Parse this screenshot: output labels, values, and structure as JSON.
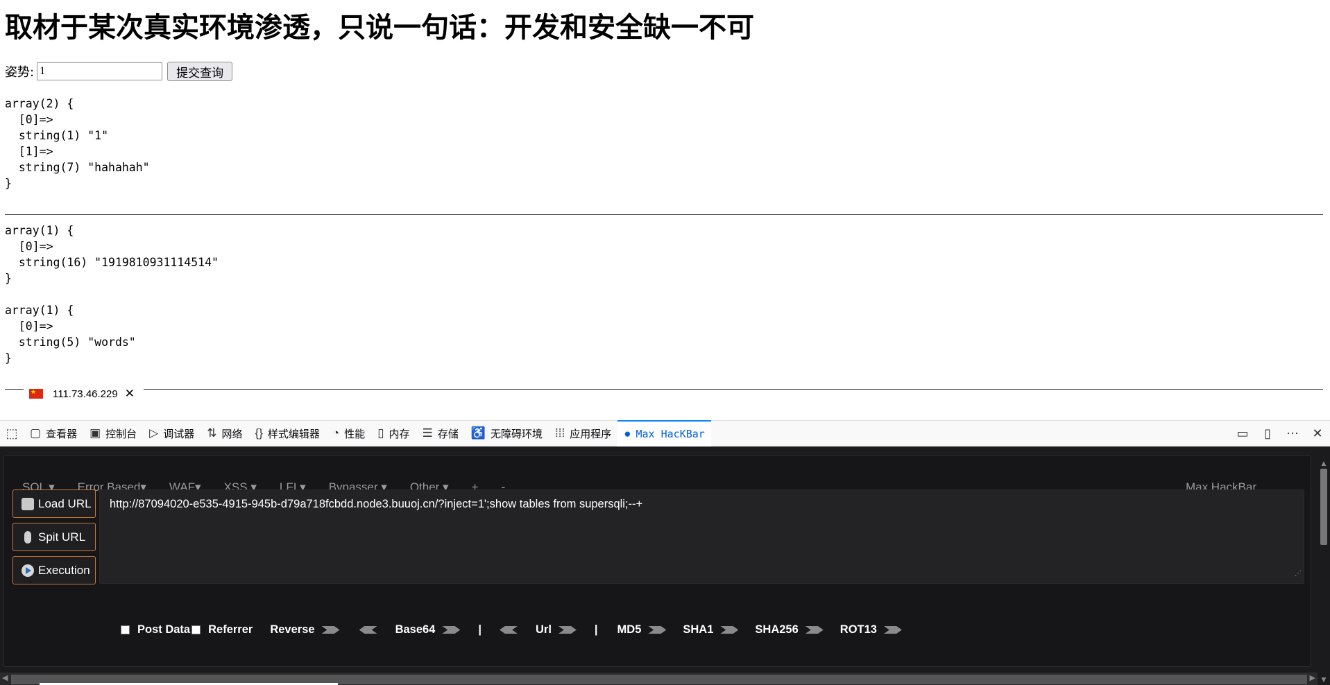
{
  "page": {
    "title": "取材于某次真实环境渗透，只说一句话：开发和安全缺一不可",
    "form": {
      "label": "姿势:",
      "value": "1",
      "submit_label": "提交查询"
    },
    "dump1": "array(2) {\n  [0]=>\n  string(1) \"1\"\n  [1]=>\n  string(7) \"hahahah\"\n}",
    "dump2": "array(1) {\n  [0]=>\n  string(16) \"1919810931114514\"\n}",
    "dump3": "array(1) {\n  [0]=>\n  string(5) \"words\"\n}",
    "ip": "111.73.46.229"
  },
  "devtools": {
    "tabs": [
      {
        "label": "查看器",
        "icon": "inspector-icon"
      },
      {
        "label": "控制台",
        "icon": "console-icon"
      },
      {
        "label": "调试器",
        "icon": "debugger-icon"
      },
      {
        "label": "网络",
        "icon": "network-icon"
      },
      {
        "label": "样式编辑器",
        "icon": "style-editor-icon"
      },
      {
        "label": "性能",
        "icon": "performance-icon"
      },
      {
        "label": "内存",
        "icon": "memory-icon"
      },
      {
        "label": "存储",
        "icon": "storage-icon"
      },
      {
        "label": "无障碍环境",
        "icon": "accessibility-icon"
      },
      {
        "label": "应用程序",
        "icon": "application-icon"
      },
      {
        "label": "Max HacKBar",
        "icon": "hackbar-icon",
        "active": true
      }
    ],
    "active_color": "#0060df"
  },
  "hackbar": {
    "menu": [
      "SQL ▾",
      "Error Based▾",
      "WAF▾",
      "XSS ▾",
      "LFI ▾",
      "Bypasser ▾",
      "Other ▾",
      "+",
      "-"
    ],
    "brand": "Max HackBar",
    "buttons": {
      "load": "Load URL",
      "split": "Spit URL",
      "exec": "Execution"
    },
    "url": "http://87094020-e535-4915-945b-d79a718fcbdd.node3.buuoj.cn/?inject=1';show tables from supersqli;--+",
    "options": {
      "post_data": "Post Data",
      "referrer": "Referrer",
      "reverse": "Reverse",
      "base64": "Base64",
      "pipe": "|",
      "url": "Url",
      "md5": "MD5",
      "sha1": "SHA1",
      "sha256": "SHA256",
      "rot13": "ROT13"
    },
    "border_color": "#c8793a"
  }
}
